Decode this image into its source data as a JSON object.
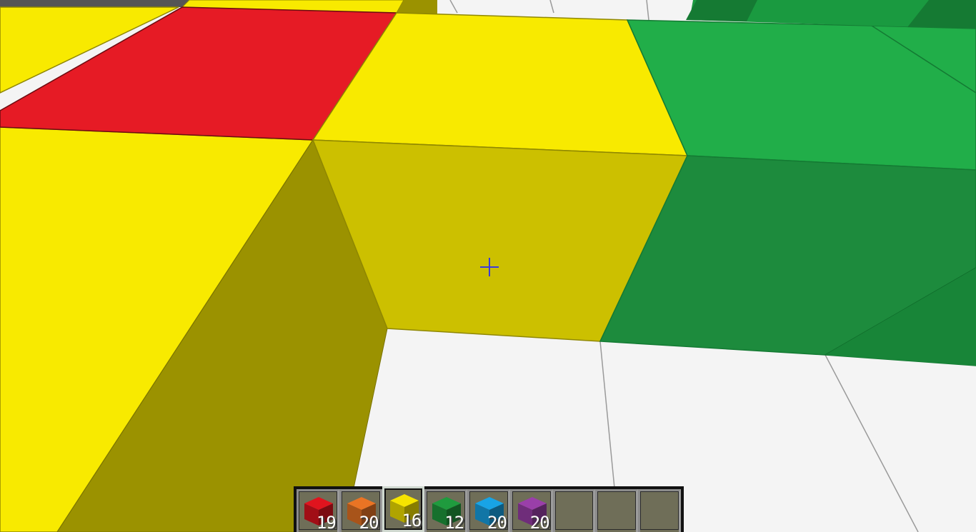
{
  "colors": {
    "yellow_top": "#f8ea00",
    "yellow_side": "#ccc000",
    "yellow_dark": "#9b9200",
    "red_top": "#e61b25",
    "green_top": "#21ae49",
    "green_side": "#1d8b3d",
    "green_dark": "#147a33",
    "floor": "#f4f4f4",
    "grey_block": "#555555",
    "crosshair": "#3b3bd9"
  },
  "hotbar": {
    "selected_index": 2,
    "slots": [
      {
        "name": "red-wool",
        "color": "#e0141e",
        "count": "19"
      },
      {
        "name": "orange-wool",
        "color": "#ea7424",
        "count": "20"
      },
      {
        "name": "yellow-wool",
        "color": "#f5e400",
        "count": "16"
      },
      {
        "name": "green-wool",
        "color": "#1f9b3e",
        "count": "12"
      },
      {
        "name": "blue-wool",
        "color": "#18a4e6",
        "count": "20"
      },
      {
        "name": "purple-wool",
        "color": "#9a3fa9",
        "count": "20"
      },
      {
        "name": "empty",
        "color": "",
        "count": ""
      },
      {
        "name": "empty",
        "color": "",
        "count": ""
      },
      {
        "name": "empty",
        "color": "",
        "count": ""
      }
    ]
  }
}
